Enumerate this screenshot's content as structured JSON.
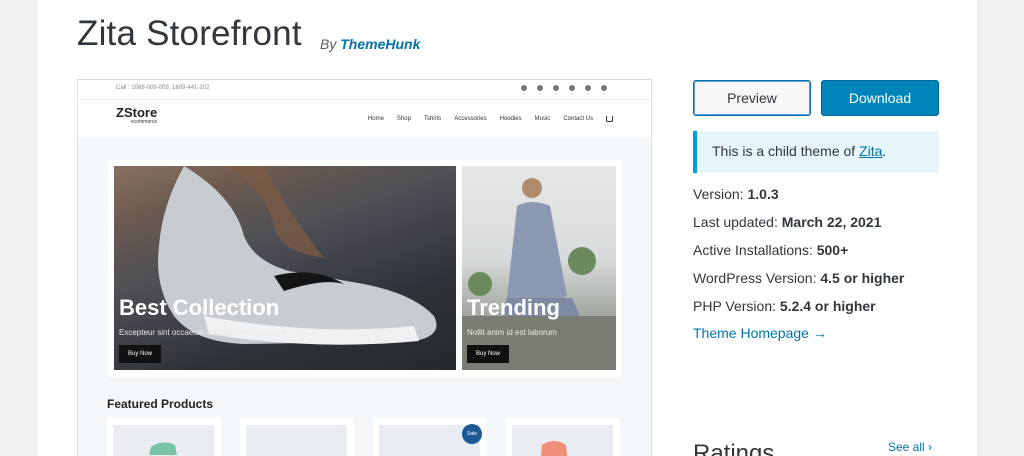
{
  "theme": {
    "title": "Zita Storefront",
    "by_prefix": "By",
    "author": "ThemeHunk"
  },
  "preview_site": {
    "call_text": "Call : 1088-009-009, 1809-441-202",
    "logo_main": "ZStore",
    "logo_sub": "ecommerce",
    "menu": [
      "Home",
      "Shop",
      "Tshirts",
      "Accessories",
      "Hoodies",
      "Music",
      "Contact Us"
    ],
    "hero_main": {
      "title": "Best Collection",
      "subtitle": "Excepteur sint occaecat cupidatat non proident",
      "button": "Buy Now"
    },
    "hero_side": {
      "title": "Trending",
      "subtitle": "Nollit anim id est laborum",
      "button": "Buy Now"
    },
    "featured_heading": "Featured Products",
    "sale_badge": "Sale"
  },
  "actions": {
    "preview_label": "Preview",
    "download_label": "Download"
  },
  "notice": {
    "prefix": "This is a child theme of ",
    "parent_link": "Zita",
    "suffix": "."
  },
  "meta": {
    "version_label": "Version: ",
    "version": "1.0.3",
    "updated_label": "Last updated: ",
    "updated": "March 22, 2021",
    "installs_label": "Active Installations: ",
    "installs": "500+",
    "wp_label": "WordPress Version: ",
    "wp": "4.5 or higher",
    "php_label": "PHP Version: ",
    "php": "5.2.4 or higher",
    "homepage_link": "Theme Homepage →"
  },
  "ratings": {
    "heading": "Ratings",
    "see_all": "See all ›"
  },
  "colors": {
    "link": "#0073aa",
    "download_button": "#0085ba",
    "notice_border": "#00a0d2",
    "notice_bg": "#e5f5fa"
  }
}
